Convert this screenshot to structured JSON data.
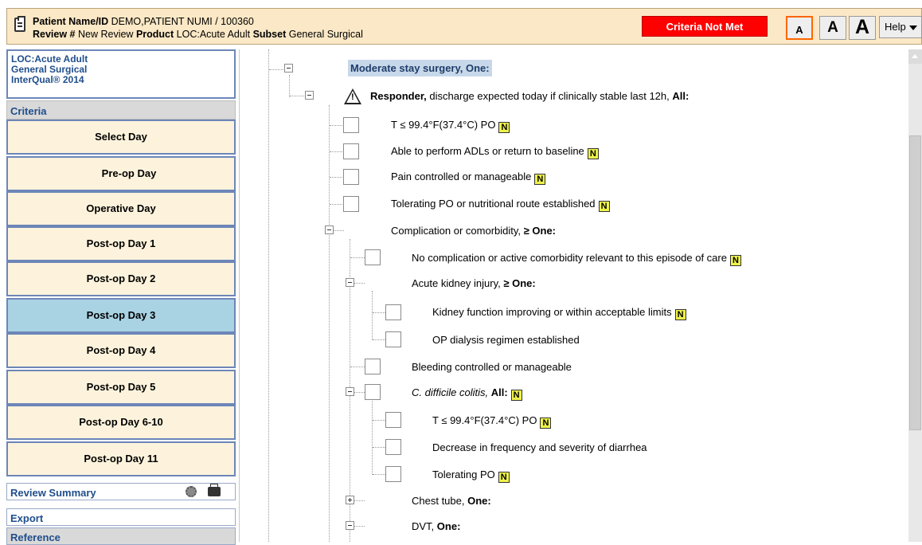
{
  "header": {
    "patient_label": "Patient Name/ID",
    "patient_value": "DEMO,PATIENT NUMI / 100360",
    "review_label": "Review #",
    "review_value": "New Review",
    "product_label": "Product",
    "product_value": "LOC:Acute Adult",
    "subset_label": "Subset",
    "subset_value": "General Surgical",
    "status": "Criteria Not Met",
    "font_small": "A",
    "font_medium": "A",
    "font_large": "A",
    "help": "Help",
    "status_color": "#ff0000"
  },
  "sidebar": {
    "product": "LOC:Acute Adult",
    "subset": "General Surgical",
    "version": "InterQual® 2014",
    "criteria": "Criteria",
    "days": [
      "Select Day",
      "Pre-op Day",
      "Operative Day",
      "Post-op Day 1",
      "Post-op Day 2",
      "Post-op Day 3",
      "Post-op Day 4",
      "Post-op Day 5",
      "Post-op Day 6-10",
      "Post-op Day 11"
    ],
    "selected_day": "Post-op Day 3",
    "review_summary": "Review Summary",
    "export": "Export",
    "reference": "Reference"
  },
  "tree": {
    "root": "Moderate stay surgery, One:",
    "responder_bold": "Responder,",
    "responder_rest": " discharge expected today if clinically stable last 12h, ",
    "responder_end": "All:",
    "items": [
      {
        "text": "T ≤ 99.4°F(37.4°C) PO",
        "note": true
      },
      {
        "text": "Able to perform ADLs or return to baseline",
        "note": true
      },
      {
        "text": "Pain controlled or manageable",
        "note": true
      },
      {
        "text": "Tolerating PO or nutritional route established",
        "note": true
      }
    ],
    "comorbidity": "Complication or comorbidity, ",
    "comorbidity_end": "≥ One:",
    "no_complication": "No complication or active comorbidity relevant to this episode of care",
    "aki": "Acute kidney injury, ",
    "aki_end": "≥ One:",
    "kidney_improving": "Kidney function improving or within acceptable limits",
    "op_dialysis": "OP dialysis regimen established",
    "bleeding": "Bleeding controlled or manageable",
    "cdiff": "C. difficile colitis,",
    "cdiff_end": "All:",
    "cdiff_temp": "T ≤ 99.4°F(37.4°C) PO",
    "diarrhea": "Decrease in frequency and severity of diarrhea",
    "tolerating": "Tolerating PO",
    "chest_tube": "Chest tube, ",
    "chest_tube_end": "One:",
    "dvt": "DVT, ",
    "dvt_end": "One:",
    "note_glyph": "N"
  }
}
